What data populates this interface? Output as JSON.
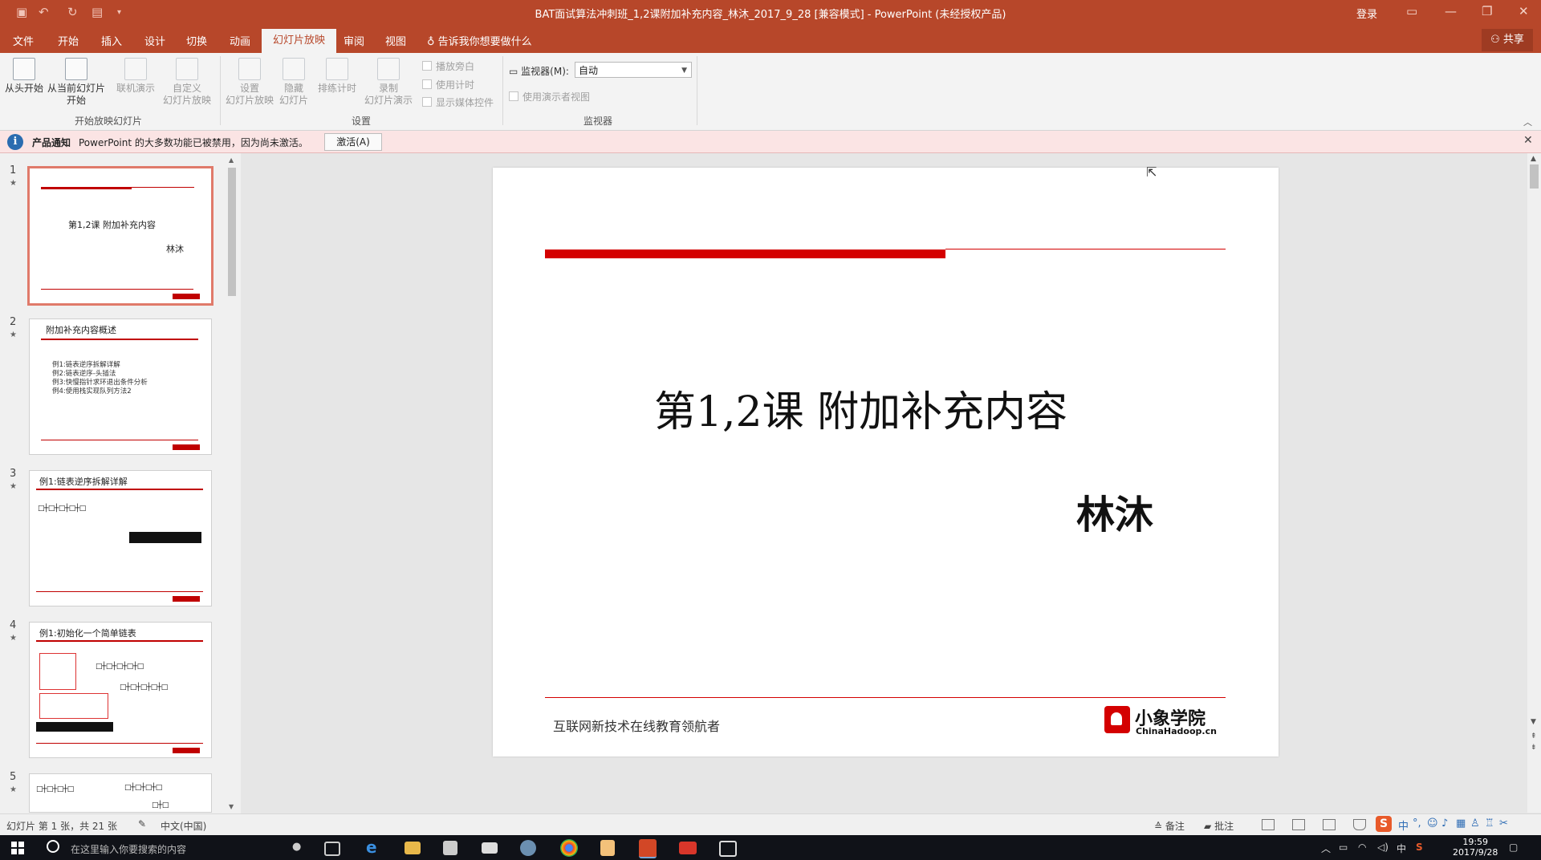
{
  "titlebar": {
    "title": "BAT面试算法冲刺班_1,2课附加补充内容_林沐_2017_9_28 [兼容模式] - PowerPoint (未经授权产品)",
    "signin": "登录"
  },
  "tabs": [
    "文件",
    "开始",
    "插入",
    "设计",
    "切换",
    "动画",
    "幻灯片放映",
    "审阅",
    "视图"
  ],
  "active_tab": "幻灯片放映",
  "tellme": "告诉我你想要做什么",
  "share": "共享",
  "ribbon": {
    "start": {
      "from_beginning": "从头开始",
      "from_current_1": "从当前幻灯片",
      "from_current_2": "开始",
      "online_1": "联机演示",
      "custom_1": "自定义",
      "custom_2": "幻灯片放映",
      "group_label": "开始放映幻灯片"
    },
    "setup": {
      "setup_1": "设置",
      "setup_2": "幻灯片放映",
      "hide_1": "隐藏",
      "hide_2": "幻灯片",
      "rehearse_1": "排练计时",
      "record_1": "录制",
      "record_2": "幻灯片演示",
      "play_narration": "播放旁白",
      "use_timings": "使用计时",
      "show_media": "显示媒体控件",
      "group_label": "设置"
    },
    "monitors": {
      "label": "监视器(M):",
      "value": "自动",
      "presenter_view": "使用演示者视图",
      "group_label": "监视器"
    }
  },
  "notification": {
    "title": "产品通知",
    "message": "PowerPoint 的大多数功能已被禁用，因为尚未激活。",
    "button": "激活(A)"
  },
  "thumbnails": [
    {
      "num": "1",
      "title": "第1,2课 附加补充内容",
      "author": "林沐"
    },
    {
      "num": "2",
      "title": "附加补充内容概述",
      "items": [
        "例1:链表逆序拆解详解",
        "例2:链表逆序-头插法",
        "例3:快慢指针求环退出条件分析",
        "例4:使用栈实现队列方法2"
      ]
    },
    {
      "num": "3",
      "title": "例1:链表逆序拆解详解"
    },
    {
      "num": "4",
      "title": "例1:初始化一个简单链表"
    },
    {
      "num": "5"
    }
  ],
  "slide": {
    "title": "第1,2课 附加补充内容",
    "author": "林沐",
    "footer": "互联网新技术在线教育领航者",
    "logo_cn": "小象学院",
    "logo_en": "ChinaHadoop.cn"
  },
  "statusbar": {
    "slide_info": "幻灯片 第 1 张，共 21 张",
    "language": "中文(中国)",
    "notes": "备注",
    "comments": "批注"
  },
  "taskbar": {
    "search_placeholder": "在这里输入你要搜索的内容",
    "time": "19:59",
    "date": "2017/9/28",
    "ime": "中"
  },
  "colors": {
    "accent": "#b7472a",
    "slide_red": "#d40000",
    "notif_bg": "#fbe4e4"
  }
}
